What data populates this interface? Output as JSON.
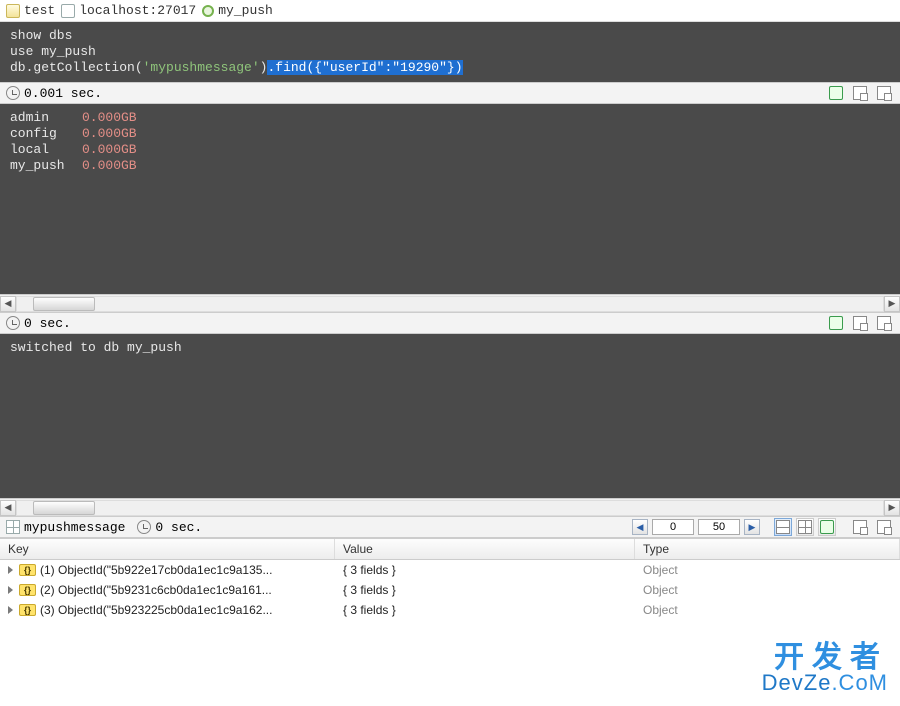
{
  "breadcrumb": {
    "folder": "test",
    "host": "localhost:27017",
    "db": "my_push"
  },
  "editor": {
    "line1": "show dbs",
    "line2": "use my_push",
    "line3a": "db.getCollection(",
    "line3str": "'mypushmessage'",
    "line3b": ")",
    "line3sel": ".find({\"userId\":\"19290\"})"
  },
  "strip1": {
    "time": "0.001 sec."
  },
  "out1": {
    "dbs": [
      {
        "name": "admin",
        "size": "0.000GB"
      },
      {
        "name": "config",
        "size": "0.000GB"
      },
      {
        "name": "local",
        "size": "0.000GB"
      },
      {
        "name": "my_push",
        "size": "0.000GB"
      }
    ]
  },
  "strip2": {
    "time": "0 sec."
  },
  "out2": {
    "msg": "switched to db my_push"
  },
  "strip3": {
    "collection": "mypushmessage",
    "time": "0 sec.",
    "pageStart": "0",
    "pageSize": "50"
  },
  "cols": {
    "key": "Key",
    "value": "Value",
    "type": "Type"
  },
  "rows": [
    {
      "key": "(1) ObjectId(\"5b922e17cb0da1ec1c9a135...",
      "value": "{ 3 fields }",
      "type": "Object"
    },
    {
      "key": "(2) ObjectId(\"5b9231c6cb0da1ec1c9a161...",
      "value": "{ 3 fields }",
      "type": "Object"
    },
    {
      "key": "(3) ObjectId(\"5b923225cb0da1ec1c9a162...",
      "value": "{ 3 fields }",
      "type": "Object"
    }
  ],
  "watermark": {
    "l1": "开发者",
    "l2a": "DevZe",
    "l2b": ".CoM"
  }
}
